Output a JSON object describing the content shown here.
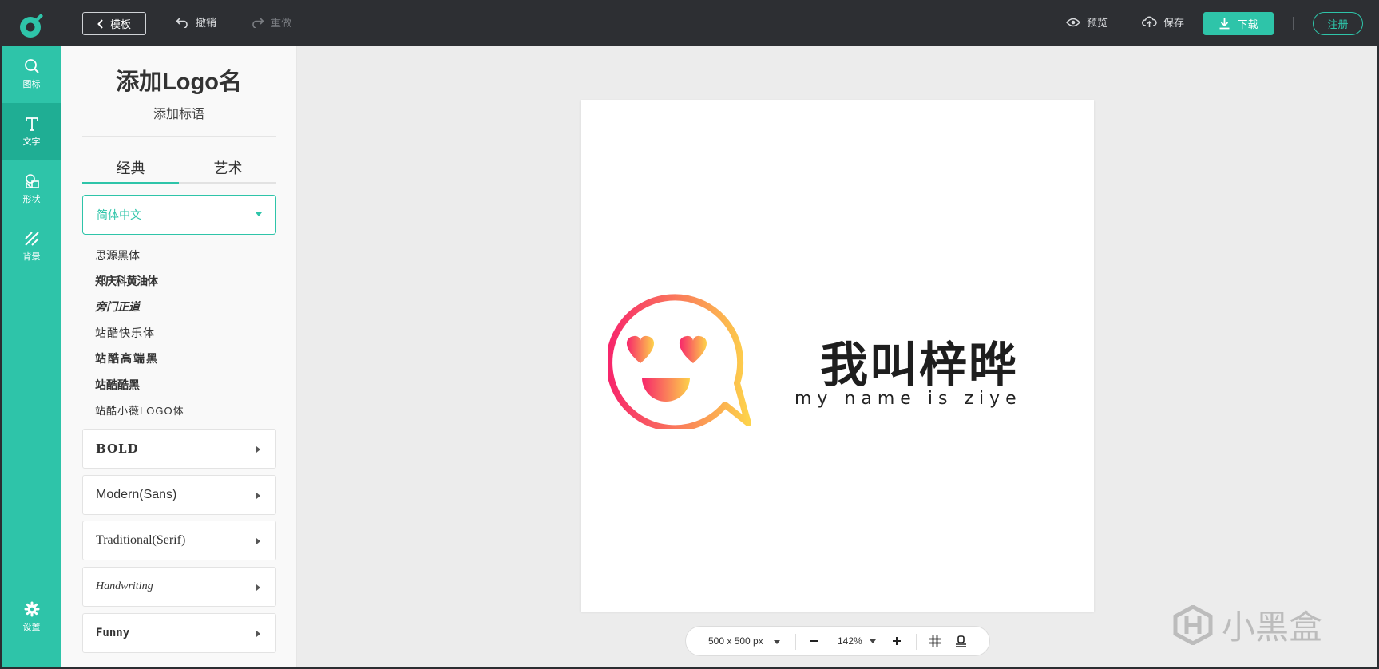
{
  "topbar": {
    "template_label": "模板",
    "undo_label": "撤销",
    "redo_label": "重做",
    "preview_label": "预览",
    "save_label": "保存",
    "download_label": "下载",
    "register_label": "注册"
  },
  "rail": {
    "items": [
      {
        "label": "图标",
        "icon": "search-icon"
      },
      {
        "label": "文字",
        "icon": "text-icon"
      },
      {
        "label": "形状",
        "icon": "shapes-icon"
      },
      {
        "label": "背景",
        "icon": "background-icon"
      }
    ],
    "settings_label": "设置",
    "active": "文字"
  },
  "panel": {
    "title": "添加Logo名",
    "subtitle": "添加标语",
    "tabs": [
      "经典",
      "艺术"
    ],
    "active_tab": "经典",
    "language_select": "简体中文",
    "fonts": [
      "思源黑体",
      "郑庆科黄油体",
      "旁门正道",
      "站酷快乐体",
      "站酷高端黑",
      "站酷酷黑",
      "站酷小薇LOGO体"
    ],
    "categories": [
      "BOLD",
      "Modern(Sans)",
      "Traditional(Serif)",
      "Handwriting",
      "Funny"
    ]
  },
  "canvas": {
    "logo_name": "我叫梓晔",
    "logo_slogan": "my name is ziye",
    "size_label": "500 x 500 px",
    "zoom_label": "142%"
  },
  "watermark": "小黑盒",
  "colors": {
    "accent": "#2ec4a9",
    "topbar": "#2d2f33",
    "gradient_start": "#f7266b",
    "gradient_end": "#fdd24a"
  }
}
